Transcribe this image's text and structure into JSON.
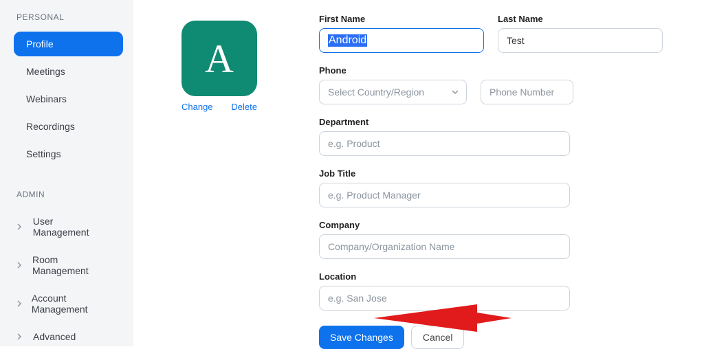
{
  "sidebar": {
    "personal_header": "PERSONAL",
    "personal": [
      {
        "label": "Profile",
        "active": true
      },
      {
        "label": "Meetings"
      },
      {
        "label": "Webinars"
      },
      {
        "label": "Recordings"
      },
      {
        "label": "Settings"
      }
    ],
    "admin_header": "ADMIN",
    "admin": [
      {
        "label": "User Management"
      },
      {
        "label": "Room Management"
      },
      {
        "label": "Account Management"
      },
      {
        "label": "Advanced"
      }
    ]
  },
  "avatar": {
    "initial": "A",
    "change_label": "Change",
    "delete_label": "Delete"
  },
  "form": {
    "first_name": {
      "label": "First Name",
      "value": "Android"
    },
    "last_name": {
      "label": "Last Name",
      "value": "Test"
    },
    "phone": {
      "label": "Phone",
      "country_placeholder": "Select Country/Region",
      "number_placeholder": "Phone Number"
    },
    "department": {
      "label": "Department",
      "placeholder": "e.g. Product"
    },
    "job_title": {
      "label": "Job Title",
      "placeholder": "e.g. Product Manager"
    },
    "company": {
      "label": "Company",
      "placeholder": "Company/Organization Name"
    },
    "location": {
      "label": "Location",
      "placeholder": "e.g. San Jose"
    }
  },
  "buttons": {
    "save": "Save Changes",
    "cancel": "Cancel"
  }
}
